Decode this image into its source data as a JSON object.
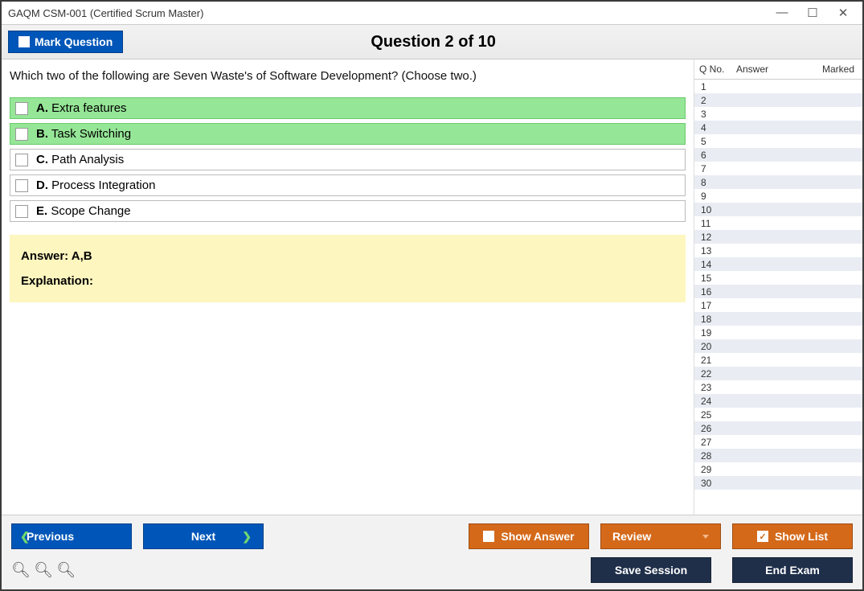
{
  "window": {
    "title": "GAQM CSM-001 (Certified Scrum Master)"
  },
  "header": {
    "mark_label": "Mark Question",
    "question_title": "Question 2 of 10"
  },
  "question": {
    "text": "Which two of the following are Seven Waste's of Software Development? (Choose two.)",
    "options": [
      {
        "letter": "A.",
        "text": "Extra features",
        "correct": true
      },
      {
        "letter": "B.",
        "text": "Task Switching",
        "correct": true
      },
      {
        "letter": "C.",
        "text": "Path Analysis",
        "correct": false
      },
      {
        "letter": "D.",
        "text": "Process Integration",
        "correct": false
      },
      {
        "letter": "E.",
        "text": "Scope Change",
        "correct": false
      }
    ],
    "answer_label": "Answer: A,B",
    "explanation_label": "Explanation:"
  },
  "side": {
    "col_q": "Q No.",
    "col_a": "Answer",
    "col_m": "Marked",
    "rows": [
      1,
      2,
      3,
      4,
      5,
      6,
      7,
      8,
      9,
      10,
      11,
      12,
      13,
      14,
      15,
      16,
      17,
      18,
      19,
      20,
      21,
      22,
      23,
      24,
      25,
      26,
      27,
      28,
      29,
      30
    ]
  },
  "footer": {
    "previous": "Previous",
    "next": "Next",
    "show_answer": "Show Answer",
    "review": "Review",
    "show_list": "Show List",
    "save_session": "Save Session",
    "end_exam": "End Exam"
  }
}
